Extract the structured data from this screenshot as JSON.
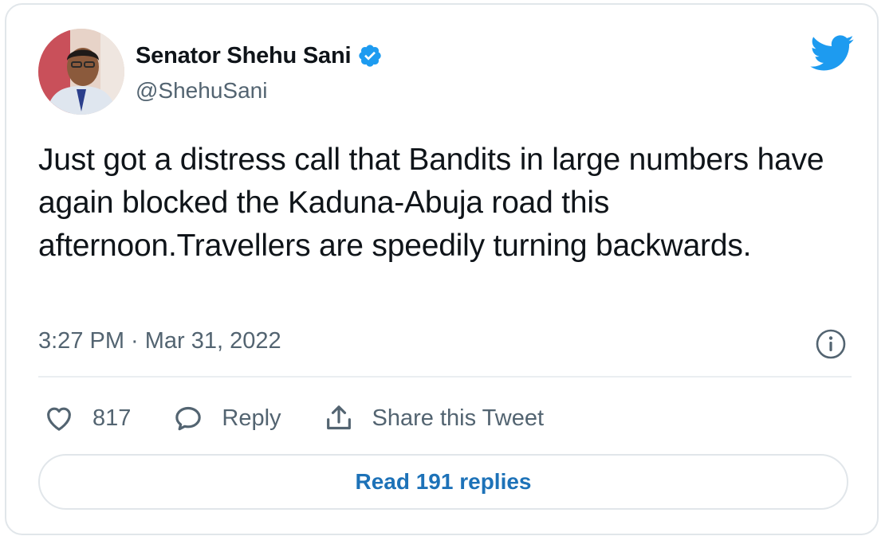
{
  "author": {
    "display_name": "Senator Shehu Sani",
    "handle": "@ShehuSani",
    "verified": true
  },
  "tweet": {
    "text": "Just got a distress call that Bandits in large numbers have again blocked the Kaduna-Abuja road this afternoon.Travellers are speedily turning backwards.",
    "timestamp": "3:27 PM · Mar 31, 2022"
  },
  "actions": {
    "like_count": "817",
    "reply_label": "Reply",
    "share_label": "Share this Tweet"
  },
  "read_replies_label": "Read 191 replies",
  "icons": {
    "brand": "twitter-bird-icon",
    "verified": "verified-badge-icon",
    "info": "info-icon",
    "like": "heart-icon",
    "reply": "reply-bubble-icon",
    "share": "share-icon"
  },
  "colors": {
    "twitter_blue": "#1d9bf0",
    "link_blue": "#1d72b8",
    "secondary_text": "#536471",
    "primary_text": "#0f1419",
    "border": "#e1e6ea"
  }
}
